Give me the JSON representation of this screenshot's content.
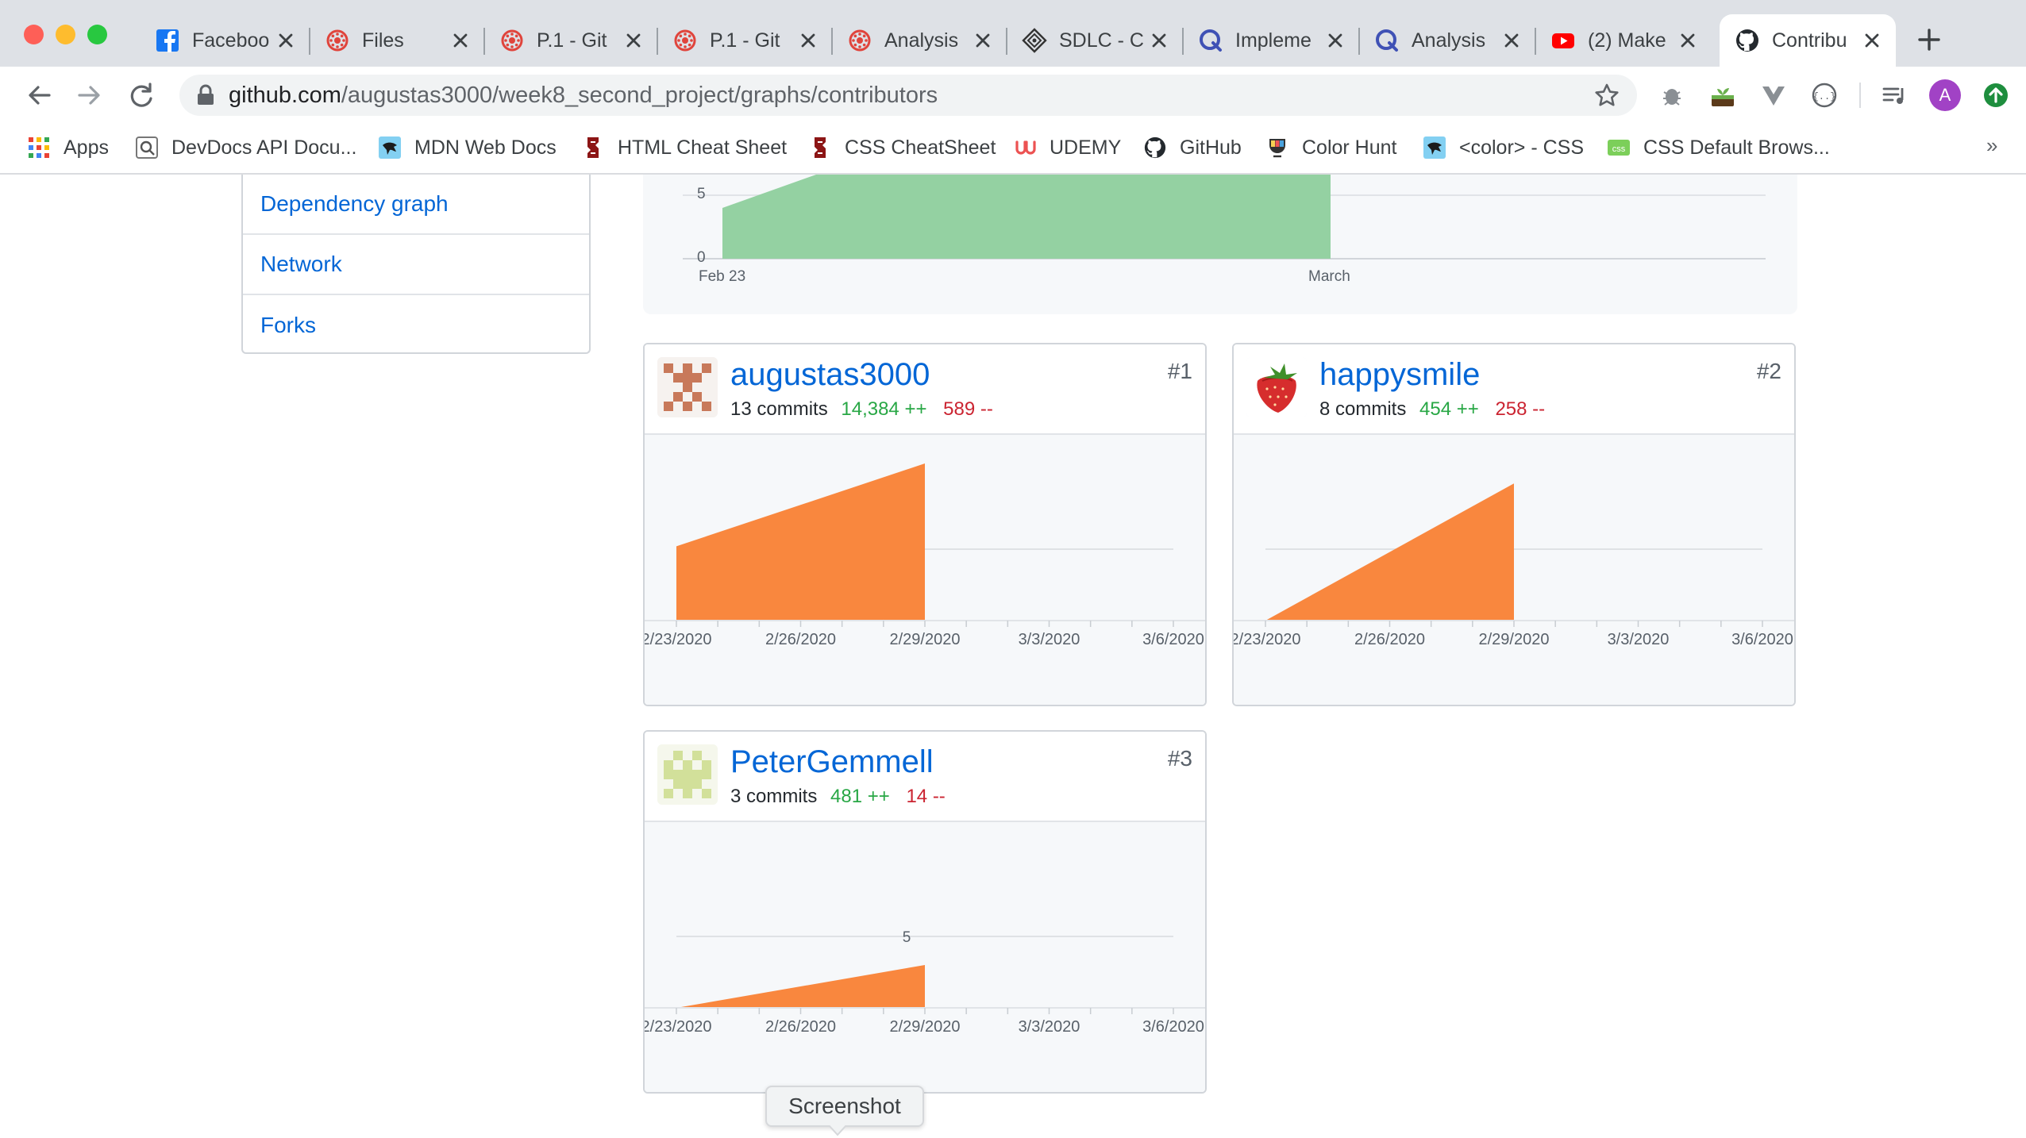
{
  "browser": {
    "tabs": [
      {
        "title": "Faceboo",
        "icon": "facebook-icon",
        "icon_color": "#1877f2"
      },
      {
        "title": "Files",
        "icon": "canvas-icon",
        "icon_color": "#e0443c"
      },
      {
        "title": "P.1 - Git",
        "icon": "canvas-icon",
        "icon_color": "#e0443c"
      },
      {
        "title": "P.1 - Git",
        "icon": "canvas-icon",
        "icon_color": "#e0443c"
      },
      {
        "title": "Analysis",
        "icon": "canvas-icon",
        "icon_color": "#e0443c"
      },
      {
        "title": "SDLC - C",
        "icon": "diamond-icon",
        "icon_color": "#333333"
      },
      {
        "title": "Impleme",
        "icon": "q-icon",
        "icon_color": "#3f51b5"
      },
      {
        "title": "Analysis",
        "icon": "q-icon",
        "icon_color": "#3f51b5"
      },
      {
        "title": "(2) Make",
        "icon": "youtube-icon",
        "icon_color": "#ff0000"
      },
      {
        "title": "Contribu",
        "icon": "github-icon",
        "icon_color": "#24292e",
        "active": true
      }
    ],
    "url": {
      "host": "github.com",
      "path": "/augustas3000/week8_second_project/graphs/contributors"
    },
    "profile_initial": "A",
    "bookmarks": [
      {
        "label": "Apps",
        "icon": "apps-grid-icon"
      },
      {
        "label": "DevDocs API Docu...",
        "icon": "devdocs-icon"
      },
      {
        "label": "MDN Web Docs",
        "icon": "mdn-icon"
      },
      {
        "label": "HTML Cheat Sheet",
        "icon": "stanford-icon"
      },
      {
        "label": "CSS CheatSheet",
        "icon": "stanford-icon"
      },
      {
        "label": "UDEMY",
        "icon": "udemy-icon"
      },
      {
        "label": "GitHub",
        "icon": "github-icon"
      },
      {
        "label": "Color Hunt",
        "icon": "colorhunt-icon"
      },
      {
        "label": "<color> - CSS",
        "icon": "mdn-icon"
      },
      {
        "label": "CSS Default Brows...",
        "icon": "css-icon"
      }
    ],
    "more_bookmarks": "»"
  },
  "sidebar": {
    "items": [
      {
        "label": "Dependency graph"
      },
      {
        "label": "Network"
      },
      {
        "label": "Forks"
      }
    ]
  },
  "overview": {
    "y_ticks": [
      "5",
      "0"
    ],
    "x_labels": [
      "Feb 23",
      "March"
    ],
    "fill_color": "#94d1a2"
  },
  "contributors": [
    {
      "name": "augustas3000",
      "commits": "13 commits",
      "additions": "14,384 ++",
      "deletions": "589 --",
      "rank": "#1",
      "avatar": "identicon-brown"
    },
    {
      "name": "happysmile",
      "commits": "8 commits",
      "additions": "454 ++",
      "deletions": "258 --",
      "rank": "#2",
      "avatar": "strawberry-avatar"
    },
    {
      "name": "PeterGemmell",
      "commits": "3 commits",
      "additions": "481 ++",
      "deletions": "14 --",
      "rank": "#3",
      "avatar": "identicon-green"
    }
  ],
  "chart_data": [
    {
      "type": "area",
      "title": "augustas3000",
      "x": [
        "2/23/2020",
        "2/29/2020"
      ],
      "y": [
        5.2,
        11.0
      ],
      "x_ticks": [
        "2/23/2020",
        "2/26/2020",
        "2/29/2020",
        "3/3/2020",
        "3/6/2020"
      ],
      "y_ticks": [],
      "color": "#f9873e"
    },
    {
      "type": "area",
      "title": "happysmile",
      "x": [
        "2/23/2020",
        "2/29/2020"
      ],
      "y": [
        0,
        9.6
      ],
      "x_ticks": [
        "2/23/2020",
        "2/26/2020",
        "2/29/2020",
        "3/3/2020",
        "3/6/2020"
      ],
      "y_ticks": [],
      "color": "#f9873e"
    },
    {
      "type": "area",
      "title": "PeterGemmell",
      "x": [
        "2/23/2020",
        "2/29/2020"
      ],
      "y": [
        0,
        3
      ],
      "x_ticks": [
        "2/23/2020",
        "2/26/2020",
        "2/29/2020",
        "3/3/2020",
        "3/6/2020"
      ],
      "y_ticks": [
        "5"
      ],
      "color": "#f9873e"
    }
  ],
  "tooltip": "Screenshot"
}
